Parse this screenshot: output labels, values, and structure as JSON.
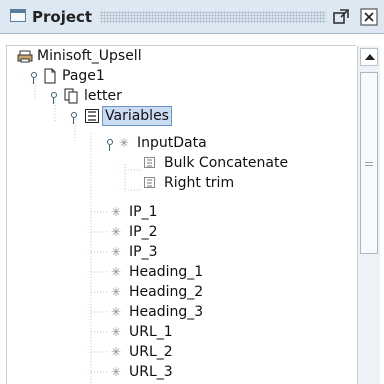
{
  "panel": {
    "title": "Project",
    "title_icon": "window-icon",
    "maximize_icon": "maximize-icon",
    "close_icon": "close-icon"
  },
  "tree": {
    "items": [
      {
        "label": "Minisoft_Upsell",
        "icon": "printer-icon"
      },
      {
        "label": "Page1",
        "icon": "page-icon"
      },
      {
        "label": "letter",
        "icon": "copy-icon"
      },
      {
        "label": "Variables",
        "icon": "variables-icon",
        "selected": true
      },
      {
        "label": "InputData",
        "icon": "asterisk-icon"
      },
      {
        "label": "Bulk Concatenate",
        "icon": "function-icon"
      },
      {
        "label": "Right trim",
        "icon": "function-icon"
      },
      {
        "label": "IP_1",
        "icon": "asterisk-icon"
      },
      {
        "label": "IP_2",
        "icon": "asterisk-icon"
      },
      {
        "label": "IP_3",
        "icon": "asterisk-icon"
      },
      {
        "label": "Heading_1",
        "icon": "asterisk-icon"
      },
      {
        "label": "Heading_2",
        "icon": "asterisk-icon"
      },
      {
        "label": "Heading_3",
        "icon": "asterisk-icon"
      },
      {
        "label": "URL_1",
        "icon": "asterisk-icon"
      },
      {
        "label": "URL_2",
        "icon": "asterisk-icon"
      },
      {
        "label": "URL_3",
        "icon": "asterisk-icon"
      }
    ]
  },
  "colors": {
    "titlebar": "#dde8f3",
    "selection": "#c9dcf3",
    "selection_border": "#6f94c3"
  }
}
